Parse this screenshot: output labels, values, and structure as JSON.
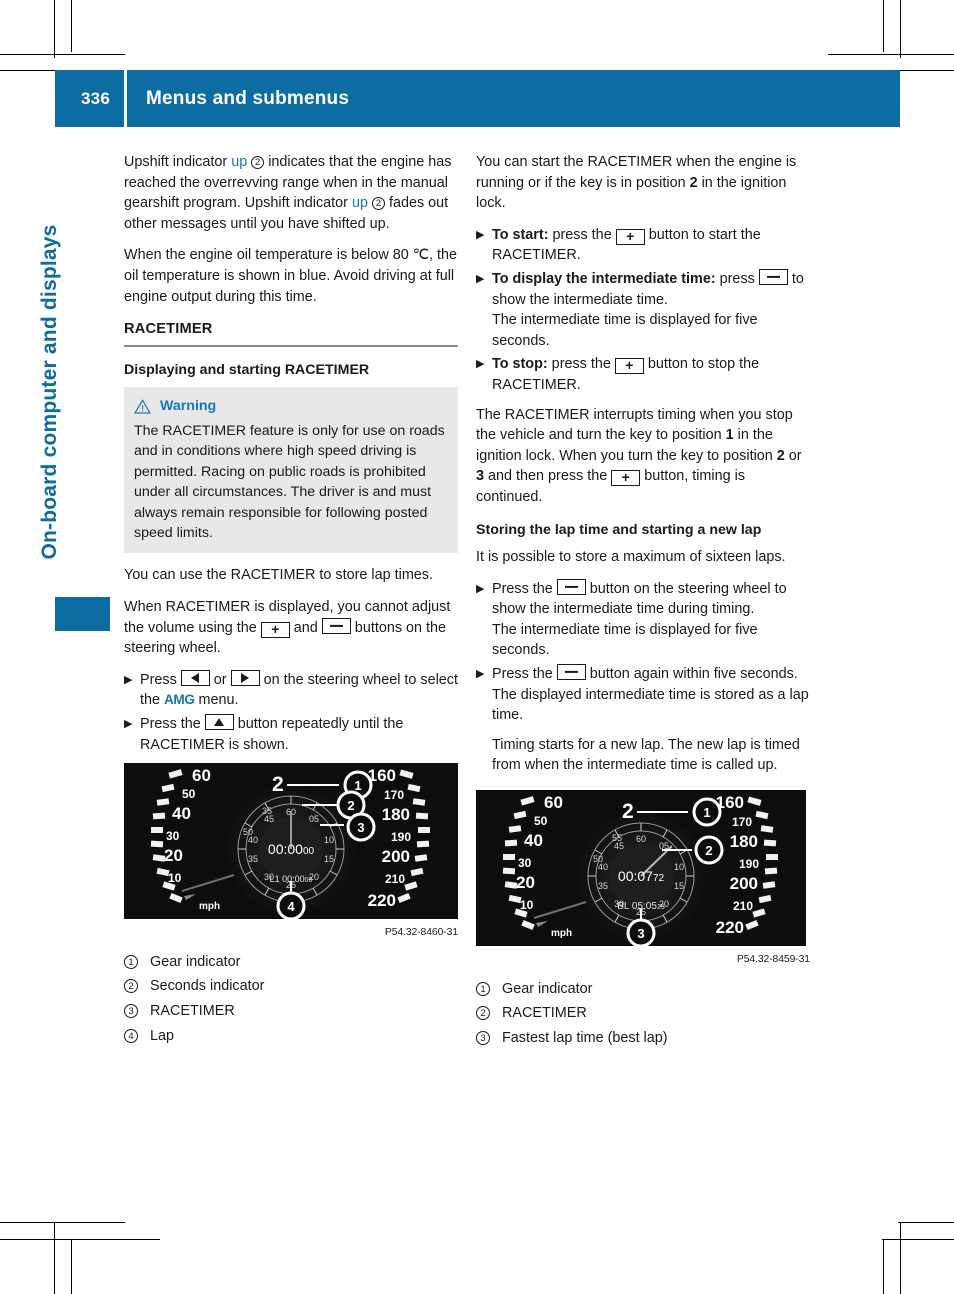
{
  "header": {
    "page_number": "336",
    "title": "Menus and submenus",
    "accent_color": "#0d6ca1"
  },
  "side_title": "On-board computer and displays",
  "left_column": {
    "paragraph_1": {
      "part1": "Upshift indicator ",
      "blue1": "up",
      "num1": "2",
      "part2": " indicates that the engine has reached the overrevving range when in the manual gearshift program. Upshift indicator ",
      "blue2": "up",
      "num2": "2",
      "part3": " fades out other messages until you have shifted up."
    },
    "paragraph_2": "When the engine oil temperature is below 80 ℃, the oil temperature is shown in blue. Avoid driving at full engine output during this time.",
    "section_heading": "RACETIMER",
    "subsection_heading": "Displaying and starting RACETIMER",
    "warning": {
      "icon": "warning-triangle-icon",
      "title": "Warning",
      "body": "The RACETIMER feature is only for use on roads and in conditions where high speed driving is permitted. Racing on public roads is prohibited under all circumstances. The driver is and must always remain responsible for following posted speed limits.",
      "background": "#e8e8e8",
      "title_color": "#1577b8"
    },
    "paragraph_3": "You can use the RACETIMER to store lap times.",
    "paragraph_4": {
      "part1": "When RACETIMER is displayed, you cannot adjust the volume using the ",
      "key1": "plus-button",
      "part2": " and ",
      "key2": "minus-button",
      "part3": " buttons on the steering wheel."
    },
    "step_1": {
      "part1": "Press ",
      "key1": "left-arrow-button",
      "part2": " or ",
      "key2": "right-arrow-button",
      "part3": " on the steering wheel to select the ",
      "menu": "AMG",
      "part4": " menu."
    },
    "step_2": {
      "part1": "Press the ",
      "key1": "up-arrow-button",
      "part2": " button repeatedly until the RACETIMER is shown."
    },
    "figure": {
      "code": "P54.32-8460-31",
      "left_scale": [
        "60",
        "50",
        "40",
        "30",
        "20",
        "10"
      ],
      "right_scale": [
        "160",
        "170",
        "180",
        "190",
        "200",
        "210",
        "220"
      ],
      "unit": "mph",
      "gear": "2",
      "timer": "00:00",
      "timer_hundredths": "00",
      "lap_label": "L1",
      "lap_time": "00:00",
      "lap_hundredths": "00",
      "seconds_ticks": [
        "60",
        "05",
        "10",
        "15",
        "20",
        "25",
        "30",
        "35",
        "40",
        "45",
        "50",
        "55"
      ],
      "callouts": [
        "1",
        "2",
        "3",
        "4"
      ]
    },
    "captions": [
      {
        "num": "1",
        "label": "Gear indicator"
      },
      {
        "num": "2",
        "label": "Seconds indicator"
      },
      {
        "num": "3",
        "label": "RACETIMER"
      },
      {
        "num": "4",
        "label": "Lap"
      }
    ]
  },
  "right_column": {
    "paragraph_1": {
      "part1": "You can start the RACETIMER when the engine is running or if the key is in position ",
      "bold1": "2",
      "part2": " in the ignition lock."
    },
    "step_start": {
      "bold": "To start:",
      "part1": " press the ",
      "key1": "plus-button",
      "part2": " button to start the RACETIMER."
    },
    "step_intermediate": {
      "bold": "To display the intermediate time:",
      "part1": " press ",
      "key1": "minus-button",
      "part2": " to show the intermediate time.",
      "sub": "The intermediate time is displayed for five seconds."
    },
    "step_stop": {
      "bold": "To stop:",
      "part1": " press the ",
      "key1": "plus-button",
      "part2": " button to stop the RACETIMER."
    },
    "paragraph_2": {
      "part1": "The RACETIMER interrupts timing when you stop the vehicle and turn the key to position ",
      "bold1": "1",
      "part2": " in the ignition lock. When you turn the key to position ",
      "bold2": "2",
      "part3": " or ",
      "bold3": "3",
      "part4": " and then press the ",
      "key1": "plus-button",
      "part5": " button, timing is continued."
    },
    "subsection_heading": "Storing the lap time and starting a new lap",
    "paragraph_3": "It is possible to store a maximum of sixteen laps.",
    "step_1": {
      "part1": "Press the ",
      "key1": "minus-button",
      "part2": " button on the steering wheel to show the intermediate time during timing.",
      "sub": "The intermediate time is displayed for five seconds."
    },
    "step_2": {
      "part1": "Press the ",
      "key1": "minus-button",
      "part2": " button again within five seconds.",
      "sub1": "The displayed intermediate time is stored as a lap time.",
      "sub2": "Timing starts for a new lap. The new lap is timed from when the intermediate time is called up."
    },
    "figure": {
      "code": "P54.32-8459-31",
      "left_scale": [
        "60",
        "50",
        "40",
        "30",
        "20",
        "10"
      ],
      "right_scale": [
        "160",
        "170",
        "180",
        "190",
        "200",
        "210",
        "220"
      ],
      "unit": "mph",
      "gear": "2",
      "timer": "00:07",
      "timer_hundredths": "72",
      "best_label": "BL",
      "best_time": "05:05",
      "best_hundredths": "25",
      "seconds_ticks": [
        "60",
        "05",
        "10",
        "15",
        "20",
        "25",
        "30",
        "35",
        "40",
        "45",
        "50",
        "55"
      ],
      "callouts": [
        "1",
        "2",
        "3"
      ]
    },
    "captions": [
      {
        "num": "1",
        "label": "Gear indicator"
      },
      {
        "num": "2",
        "label": "RACETIMER"
      },
      {
        "num": "3",
        "label": "Fastest lap time (best lap)"
      }
    ]
  }
}
